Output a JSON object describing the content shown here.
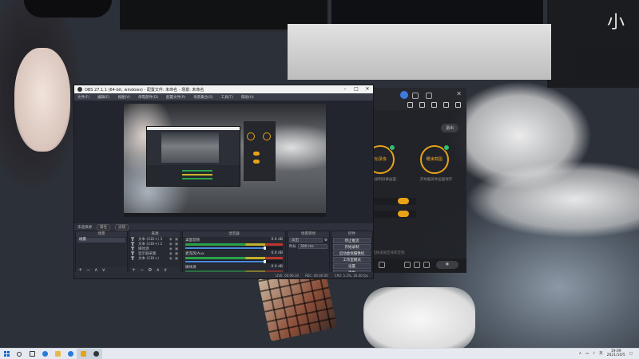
{
  "wallpaper": {
    "watermark": "小"
  },
  "obs": {
    "title": "OBS 27.1.1 (64-bit, windows) - 配置文件: 未命名 - 场景: 未命名",
    "menu": [
      "文件(F)",
      "编辑(E)",
      "视图(V)",
      "停靠部件(D)",
      "配置文件(P)",
      "场景集合(S)",
      "工具(T)",
      "帮助(H)"
    ],
    "toolbar": {
      "no_source": "未选择源",
      "properties": "属性",
      "filters": "滤镜"
    },
    "docks": {
      "scenes": {
        "title": "场景",
        "items": [
          "场景"
        ]
      },
      "sources": {
        "title": "来源",
        "items": [
          {
            "type": "T",
            "name": "文本 (GDI+) 3"
          },
          {
            "type": "T",
            "name": "文本 (GDI+) 2"
          },
          {
            "type": "T",
            "name": "媒体源"
          },
          {
            "type": "T",
            "name": "显示器采集"
          },
          {
            "type": "T",
            "name": "文本 (GDI+)"
          }
        ]
      },
      "mixer": {
        "title": "混音器",
        "tracks": [
          {
            "name": "桌面音频",
            "level": "0.0 dB",
            "fader": 0.82
          },
          {
            "name": "麦克风/Aux",
            "level": "0.0 dB",
            "fader": 0.82
          },
          {
            "name": "媒体源",
            "level": "0.0 dB",
            "fader": 0.82
          }
        ]
      },
      "transitions": {
        "title": "场景转场",
        "type": "淡出",
        "duration_label": "时长",
        "duration": "300 ms"
      },
      "controls": {
        "title": "控件",
        "buttons": [
          "停止推流",
          "开始录制",
          "启动虚拟摄像机",
          "工作室模式",
          "设置",
          "退出"
        ]
      }
    },
    "status": [
      "LIVE: 00:06:30",
      "REC: 00:00:00",
      "CPU: 5.2%, 30.00 fps"
    ]
  },
  "recorder": {
    "badge": "退出",
    "circles": [
      {
        "label": "开始录像",
        "sub": "开始录制屏幕画面"
      },
      {
        "label": "结束截图",
        "sub": "开始截屏并画面保存"
      }
    ],
    "vs": "或",
    "note": "选择录屏区域和音频"
  },
  "taskbar": {
    "time": "19:09",
    "date": "2021/10/5"
  },
  "colors": {
    "accent": "#e8a217",
    "obs_bg": "#2b2e38",
    "taskbar": "#e6eaf0"
  }
}
